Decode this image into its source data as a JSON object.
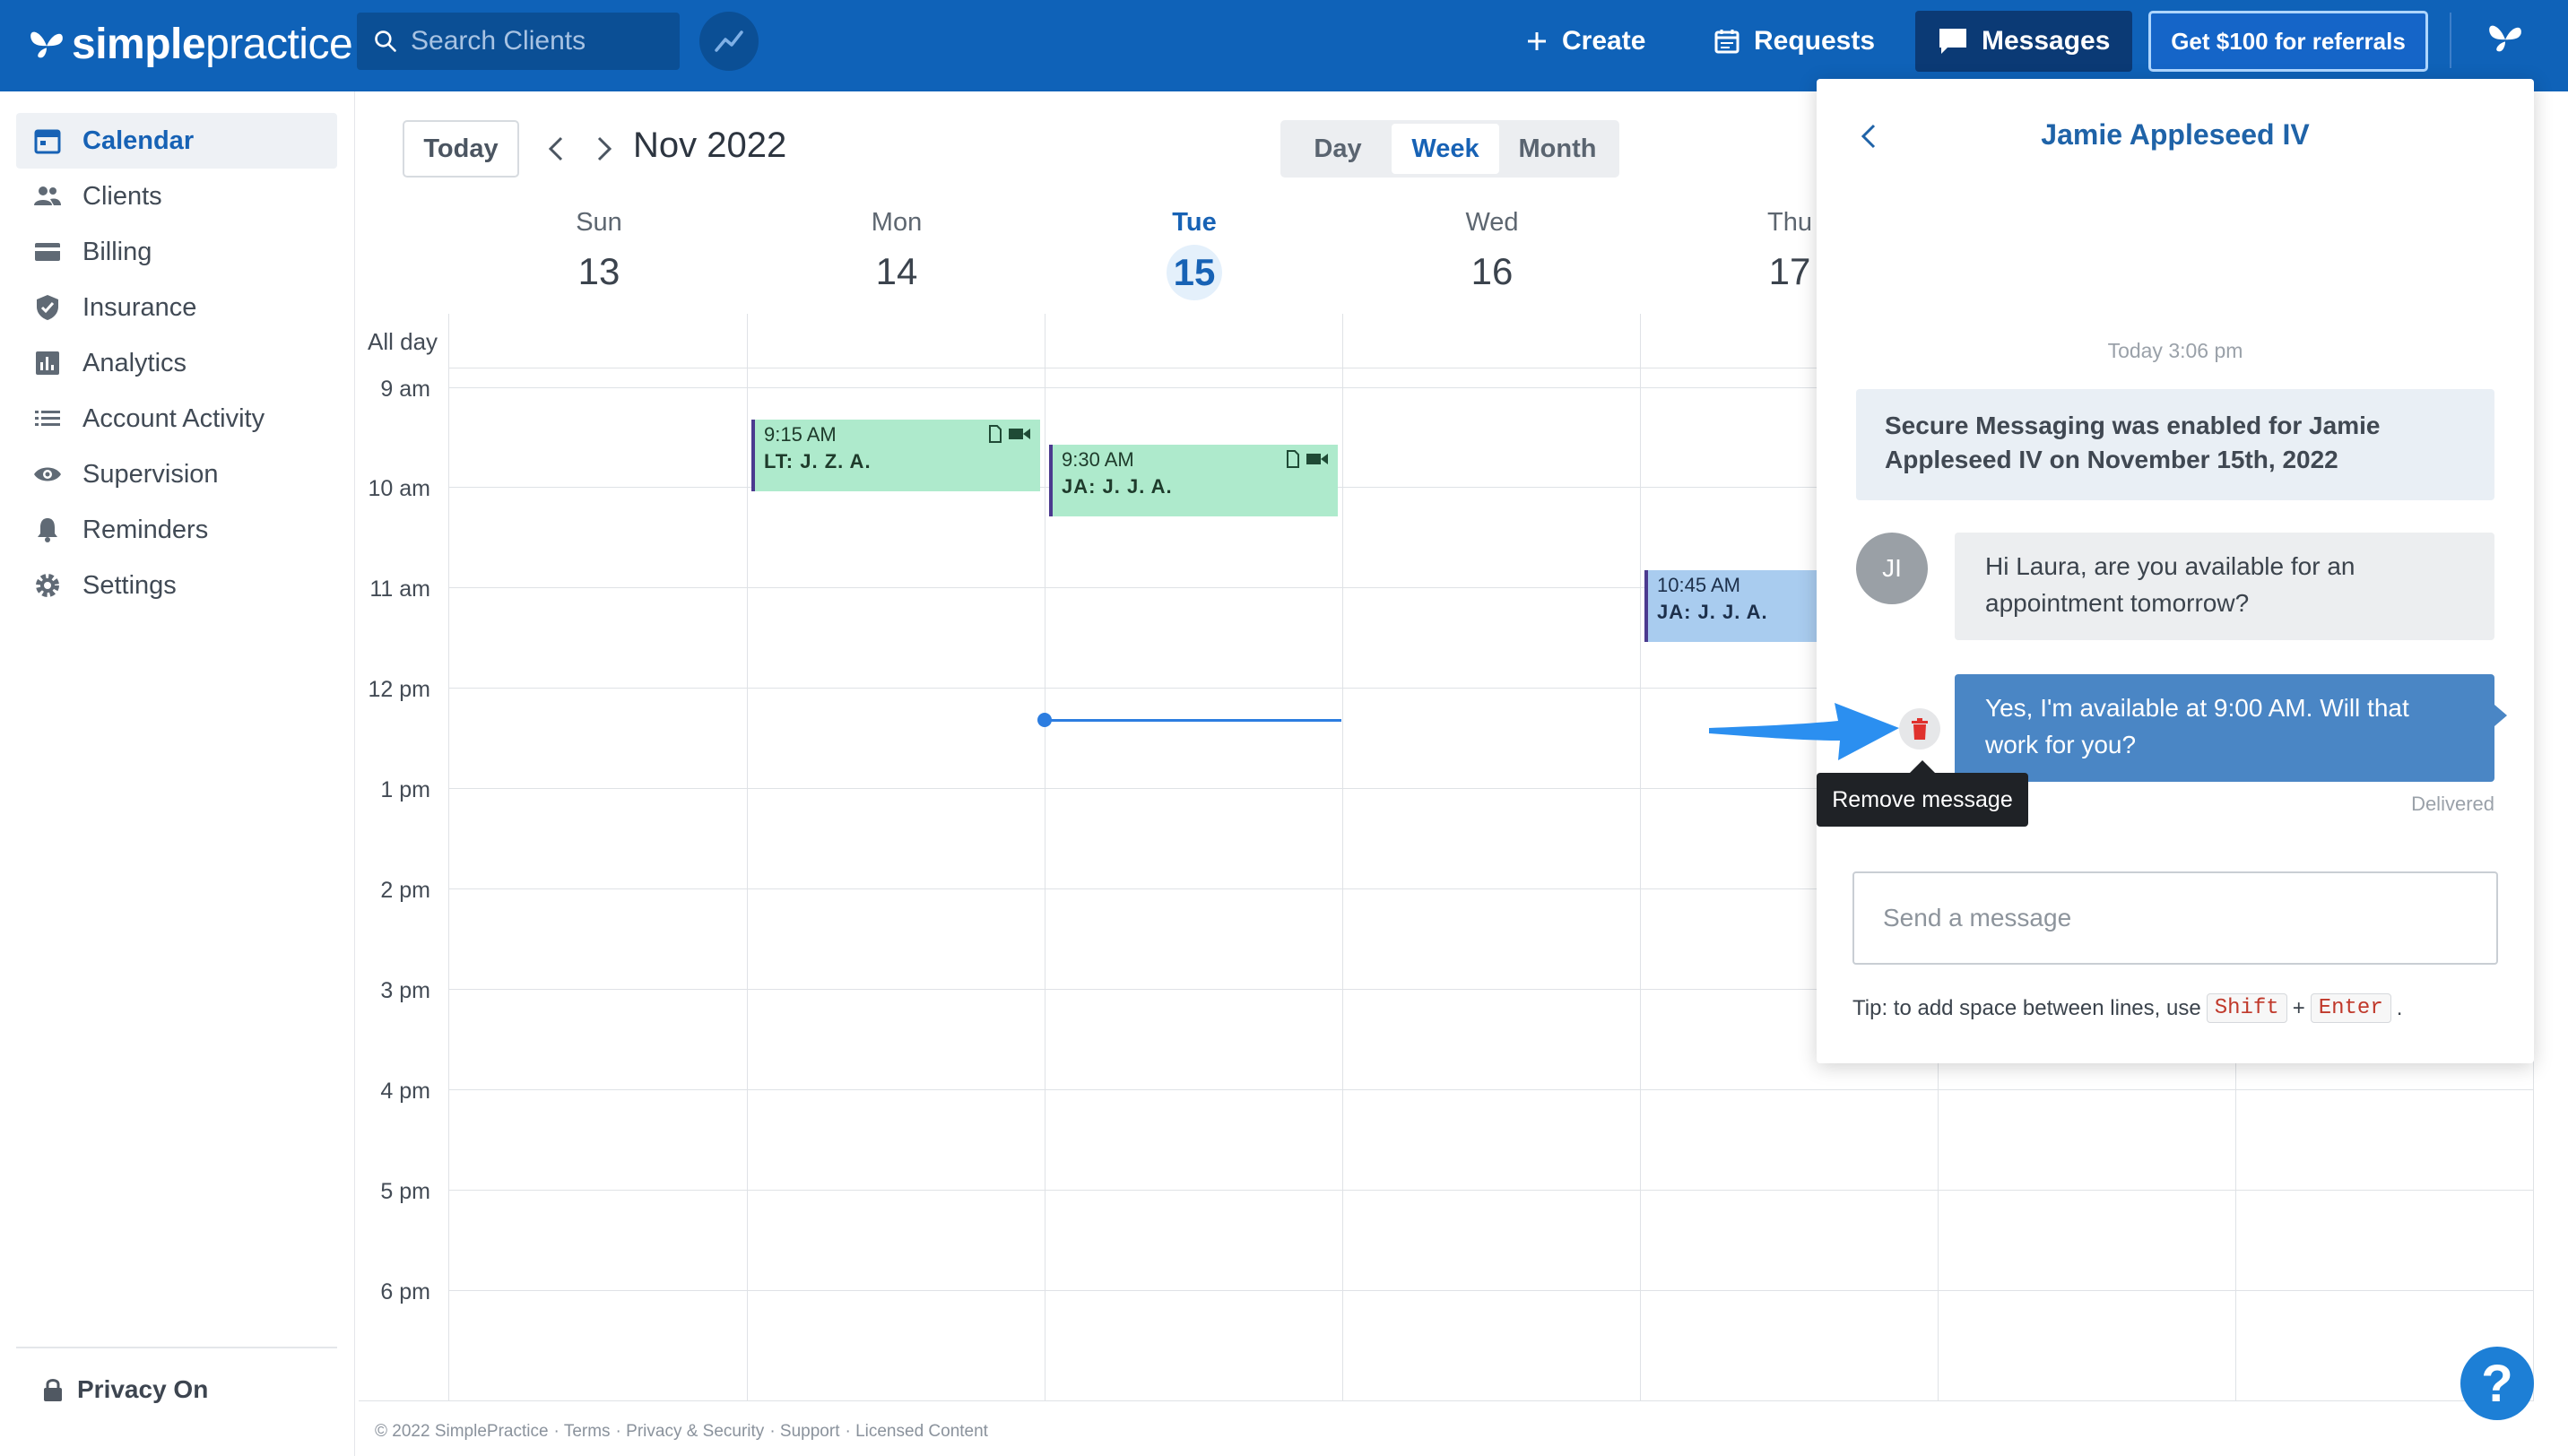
{
  "topbar": {
    "logo_simple": "simple",
    "logo_practice": "practice",
    "search_placeholder": "Search Clients",
    "create_label": "Create",
    "requests_label": "Requests",
    "messages_label": "Messages",
    "referral_label": "Get $100 for referrals"
  },
  "sidebar": {
    "items": [
      {
        "label": "Calendar",
        "icon": "calendar-icon",
        "active": true
      },
      {
        "label": "Clients",
        "icon": "clients-icon"
      },
      {
        "label": "Billing",
        "icon": "billing-icon"
      },
      {
        "label": "Insurance",
        "icon": "shield-icon"
      },
      {
        "label": "Analytics",
        "icon": "analytics-icon"
      },
      {
        "label": "Account Activity",
        "icon": "list-icon"
      },
      {
        "label": "Supervision",
        "icon": "eye-icon"
      },
      {
        "label": "Reminders",
        "icon": "bell-icon"
      },
      {
        "label": "Settings",
        "icon": "gear-icon"
      }
    ],
    "privacy_label": "Privacy On"
  },
  "calendar": {
    "today_label": "Today",
    "month_title": "Nov 2022",
    "views": [
      "Day",
      "Week",
      "Month"
    ],
    "active_view": "Week",
    "days": [
      {
        "name": "Sun",
        "date": "13"
      },
      {
        "name": "Mon",
        "date": "14"
      },
      {
        "name": "Tue",
        "date": "15",
        "today": true
      },
      {
        "name": "Wed",
        "date": "16"
      },
      {
        "name": "Thu",
        "date": "17"
      }
    ],
    "allday_label": "All day",
    "times": [
      "9 am",
      "10 am",
      "11 am",
      "12 pm",
      "1 pm",
      "2 pm",
      "3 pm",
      "4 pm",
      "5 pm",
      "6 pm"
    ],
    "events": [
      {
        "day": "Mon",
        "time": "9:15 AM",
        "client": "LT: J. Z. A.",
        "color": "#aeeacc"
      },
      {
        "day": "Tue",
        "time": "9:30 AM",
        "client": "JA: J. J. A.",
        "color": "#aeeacc"
      },
      {
        "day": "Thu",
        "time": "10:45 AM",
        "client": "JA: J. J. A.",
        "color": "#a9ccef"
      }
    ]
  },
  "footer": {
    "copyright": "© 2022 SimplePractice",
    "links": [
      "Terms",
      "Privacy & Security",
      "Support",
      "Licensed Content"
    ]
  },
  "messages": {
    "title": "Jamie Appleseed IV",
    "timestamp": "Today 3:06 pm",
    "system_message": "Secure Messaging was enabled for Jamie Appleseed IV on November 15th, 2022",
    "avatar_initials": "JI",
    "incoming_message": "Hi Laura, are you available for an appointment tomorrow?",
    "outgoing_message": "Yes, I'm available at 9:00 AM. Will that work for you?",
    "delivered_label": "Delivered",
    "tooltip": "Remove message",
    "compose_placeholder": "Send a message",
    "tip_prefix": "Tip: to add space between lines, use",
    "tip_key1": "Shift",
    "tip_plus": "+",
    "tip_key2": "Enter",
    "tip_suffix": "."
  },
  "help_label": "?",
  "colors": {
    "topbar": "#0f62b8",
    "accent": "#1762b5",
    "outgoing_bubble": "#4a86c5",
    "event_green": "#aeeacc",
    "event_blue": "#a9ccef",
    "arrow": "#2b8ff0"
  }
}
